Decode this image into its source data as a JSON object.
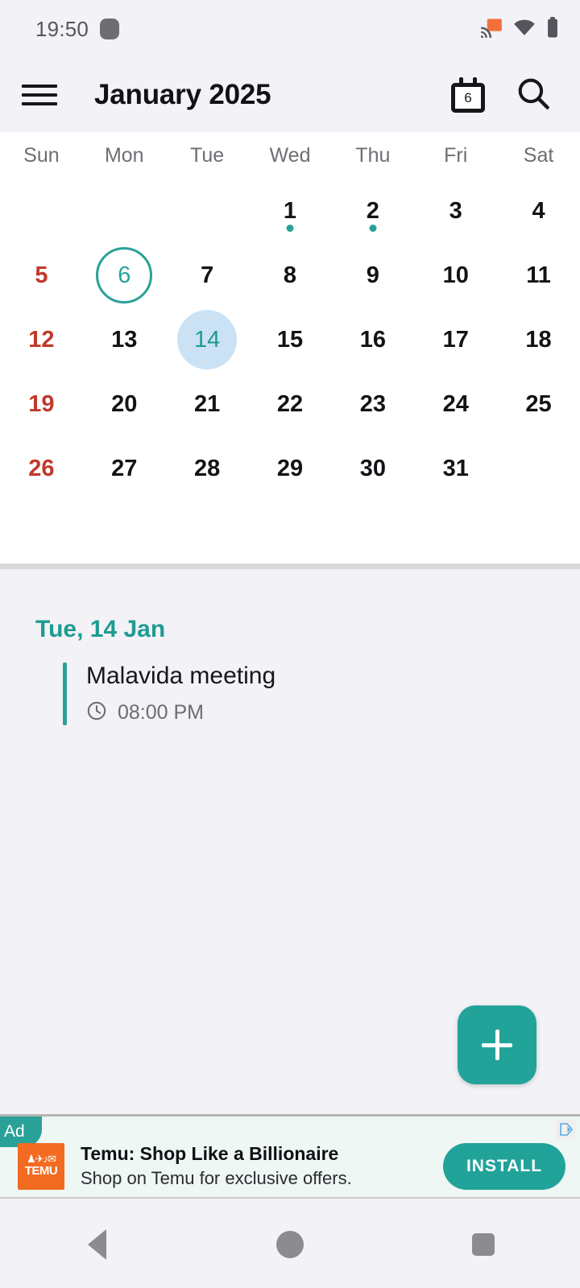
{
  "status_bar": {
    "time": "19:50",
    "icons": [
      "notification-badge-icon",
      "cast-icon",
      "wifi-icon",
      "battery-icon"
    ]
  },
  "toolbar": {
    "menu_icon": "hamburger-menu-icon",
    "title": "January 2025",
    "today_icon_day": "6",
    "search_icon": "search-icon"
  },
  "calendar": {
    "day_headers": [
      "Sun",
      "Mon",
      "Tue",
      "Wed",
      "Thu",
      "Fri",
      "Sat"
    ],
    "weeks": [
      [
        {
          "d": "",
          "t": "empty"
        },
        {
          "d": "",
          "t": "empty"
        },
        {
          "d": "",
          "t": "empty"
        },
        {
          "d": "1",
          "t": "day",
          "dot": true
        },
        {
          "d": "2",
          "t": "day",
          "dot": true
        },
        {
          "d": "3",
          "t": "day"
        },
        {
          "d": "4",
          "t": "day"
        }
      ],
      [
        {
          "d": "5",
          "t": "sun"
        },
        {
          "d": "6",
          "t": "today"
        },
        {
          "d": "7",
          "t": "day"
        },
        {
          "d": "8",
          "t": "day"
        },
        {
          "d": "9",
          "t": "day"
        },
        {
          "d": "10",
          "t": "day"
        },
        {
          "d": "11",
          "t": "day"
        }
      ],
      [
        {
          "d": "12",
          "t": "sun"
        },
        {
          "d": "13",
          "t": "day"
        },
        {
          "d": "14",
          "t": "selected"
        },
        {
          "d": "15",
          "t": "day"
        },
        {
          "d": "16",
          "t": "day"
        },
        {
          "d": "17",
          "t": "day"
        },
        {
          "d": "18",
          "t": "day"
        }
      ],
      [
        {
          "d": "19",
          "t": "sun"
        },
        {
          "d": "20",
          "t": "day"
        },
        {
          "d": "21",
          "t": "day"
        },
        {
          "d": "22",
          "t": "day"
        },
        {
          "d": "23",
          "t": "day"
        },
        {
          "d": "24",
          "t": "day"
        },
        {
          "d": "25",
          "t": "day"
        }
      ],
      [
        {
          "d": "26",
          "t": "sun"
        },
        {
          "d": "27",
          "t": "day"
        },
        {
          "d": "28",
          "t": "day"
        },
        {
          "d": "29",
          "t": "day"
        },
        {
          "d": "30",
          "t": "day"
        },
        {
          "d": "31",
          "t": "day"
        },
        {
          "d": "",
          "t": "empty"
        }
      ]
    ]
  },
  "events": {
    "date_label": "Tue, 14 Jan",
    "items": [
      {
        "title": "Malavida meeting",
        "time": "08:00 PM",
        "time_icon": "clock-icon"
      }
    ]
  },
  "fab": {
    "label": "+",
    "name": "add-event-button"
  },
  "ad": {
    "badge": "Ad",
    "title": "Temu: Shop Like a Billionaire",
    "subtitle": "Shop on Temu for exclusive offers.",
    "cta": "INSTALL",
    "logo_word": "TEMU",
    "logo_glyphs": "♟✈♪✉",
    "adchoices_icon": "adchoices-icon"
  },
  "nav_bar": {
    "back": "back-button",
    "home": "home-button",
    "recents": "recents-button"
  },
  "colors": {
    "accent_teal": "#2aa198",
    "sunday_red": "#c0392b",
    "selected_blue": "#cbe2f5",
    "ad_orange": "#f26b21"
  }
}
